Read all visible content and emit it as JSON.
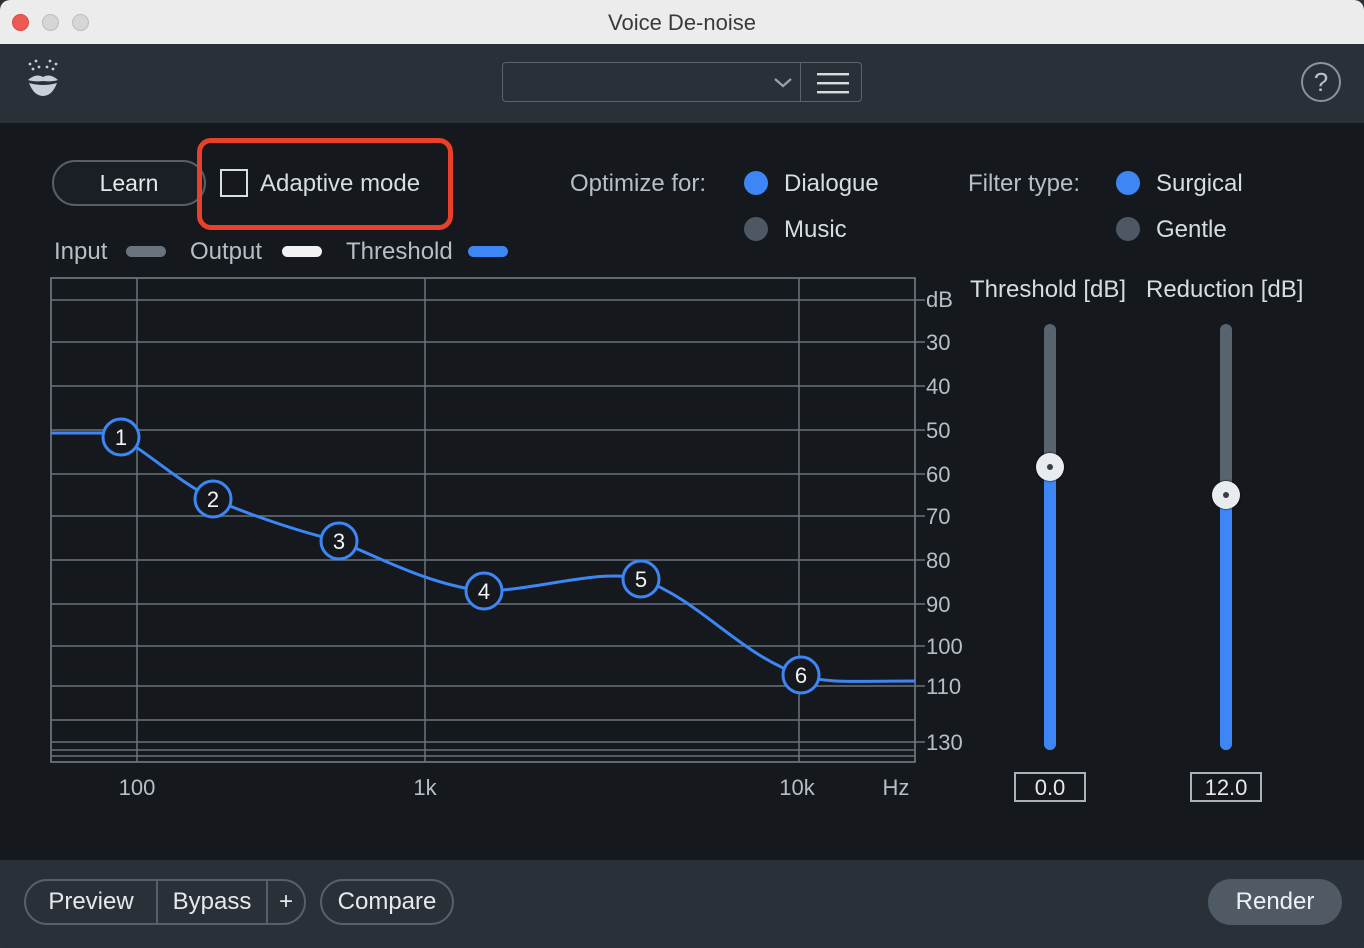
{
  "window": {
    "title": "Voice De-noise"
  },
  "toolbar": {
    "preset_value": "",
    "help_label": "?"
  },
  "controls": {
    "learn_label": "Learn",
    "adaptive_label": "Adaptive mode",
    "adaptive_checked": false,
    "optimize_label": "Optimize for:",
    "optimize_options": [
      "Dialogue",
      "Music"
    ],
    "optimize_selected": "Dialogue",
    "filter_label": "Filter type:",
    "filter_options": [
      "Surgical",
      "Gentle"
    ],
    "filter_selected": "Surgical"
  },
  "legend": {
    "items": [
      {
        "label": "Input",
        "color": "#6b747e"
      },
      {
        "label": "Output",
        "color": "#f2f2f2"
      },
      {
        "label": "Threshold",
        "color": "#3d86f5"
      }
    ]
  },
  "graph": {
    "db_unit": "dB",
    "db_ticks": [
      "30",
      "40",
      "50",
      "60",
      "70",
      "80",
      "90",
      "100",
      "110",
      "130"
    ],
    "freq_ticks": [
      "100",
      "1k",
      "10k"
    ],
    "freq_unit": "Hz",
    "nodes": [
      "1",
      "2",
      "3",
      "4",
      "5",
      "6"
    ],
    "curve_color": "#3d86f5"
  },
  "sliders": {
    "threshold": {
      "label": "Threshold [dB]",
      "value": "0.0",
      "level": 0.67
    },
    "reduction": {
      "label": "Reduction [dB]",
      "value": "12.0",
      "level": 0.6
    }
  },
  "footer": {
    "preview_label": "Preview",
    "bypass_label": "Bypass",
    "plus_label": "+",
    "compare_label": "Compare",
    "render_label": "Render"
  }
}
